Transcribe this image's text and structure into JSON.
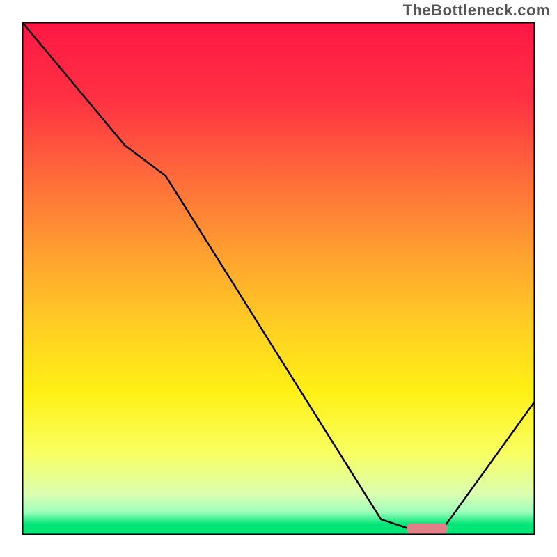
{
  "watermark": "TheBottleneck.com",
  "chart_data": {
    "type": "line",
    "title": "",
    "xlabel": "",
    "ylabel": "",
    "xlim": [
      0,
      100
    ],
    "ylim": [
      0,
      100
    ],
    "grid": false,
    "legend": false,
    "background": {
      "type": "vertical-gradient",
      "stops": [
        {
          "pos": 0.0,
          "color": "#ff1744"
        },
        {
          "pos": 0.15,
          "color": "#ff3143"
        },
        {
          "pos": 0.3,
          "color": "#ff6a3a"
        },
        {
          "pos": 0.45,
          "color": "#ffa030"
        },
        {
          "pos": 0.6,
          "color": "#ffd022"
        },
        {
          "pos": 0.72,
          "color": "#fff014"
        },
        {
          "pos": 0.84,
          "color": "#f8ff60"
        },
        {
          "pos": 0.92,
          "color": "#dcffb0"
        },
        {
          "pos": 0.955,
          "color": "#a0ffbc"
        },
        {
          "pos": 0.98,
          "color": "#00e676"
        },
        {
          "pos": 1.0,
          "color": "#00e676"
        }
      ]
    },
    "series": [
      {
        "name": "bottleneck-curve",
        "color": "#000000",
        "width": 2.5,
        "x": [
          0,
          20,
          28,
          70,
          76,
          82,
          100
        ],
        "y": [
          100,
          76,
          70,
          3,
          1,
          1,
          26
        ]
      }
    ],
    "marker": {
      "name": "optimal-range",
      "shape": "rounded-bar",
      "color": "#e08088",
      "x_center": 79,
      "y_center": 1.2,
      "width_pct": 8,
      "height_pct": 2
    }
  }
}
